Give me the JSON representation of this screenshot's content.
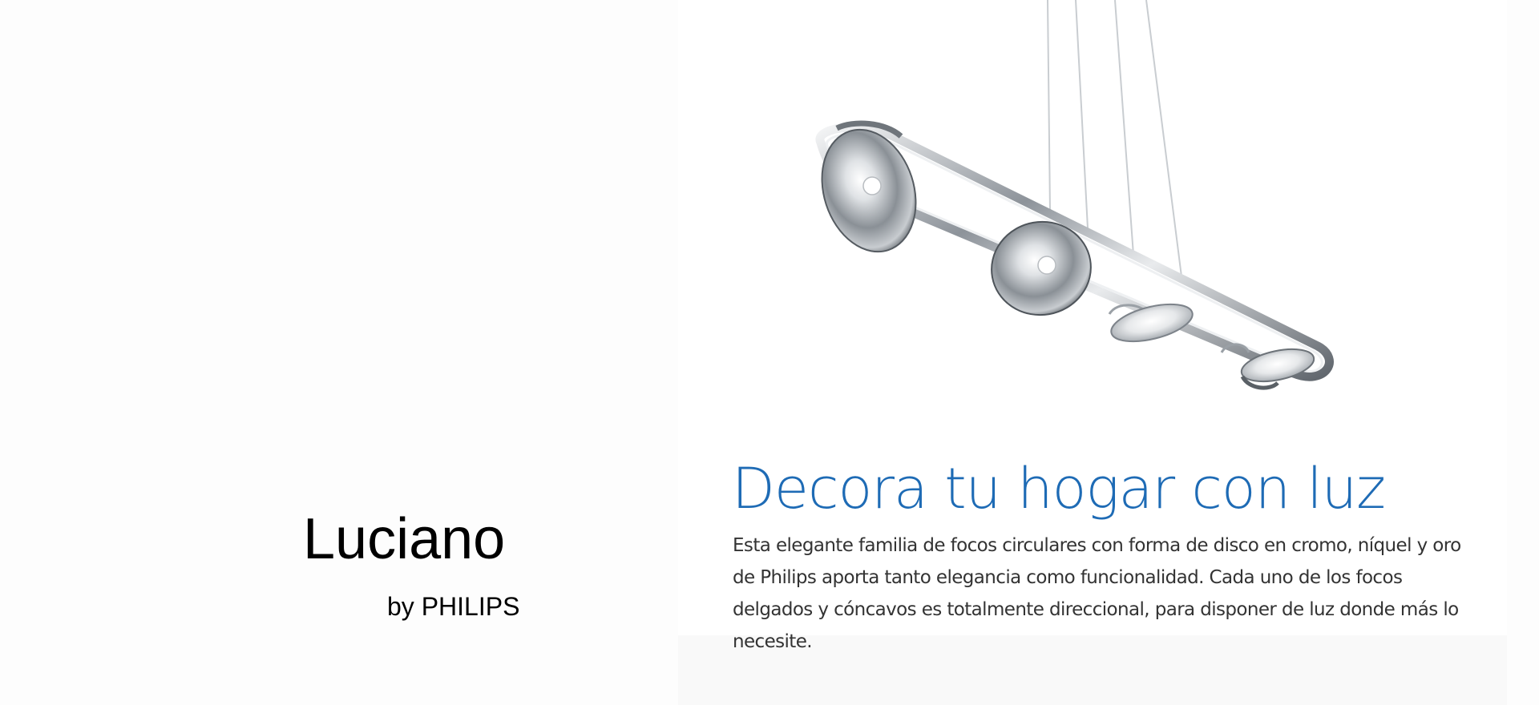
{
  "cover": {
    "product_name": "Luciano",
    "brand_line": "by PHILIPS"
  },
  "feature": {
    "headline": "Decora tu hogar con luz",
    "body": "Esta elegante familia de focos circulares con forma de disco en cromo, níquel y oro de Philips aporta tanto elegancia como funcionalidad. Cada uno de los focos delgados y cóncavos es totalmente direccional, para disponer de luz donde más lo necesite."
  },
  "colors": {
    "headline": "#1e6bb5",
    "body_text": "#333333",
    "title_text": "#000000",
    "background": "#fdfdfd",
    "chrome": "#9aa0a6"
  }
}
